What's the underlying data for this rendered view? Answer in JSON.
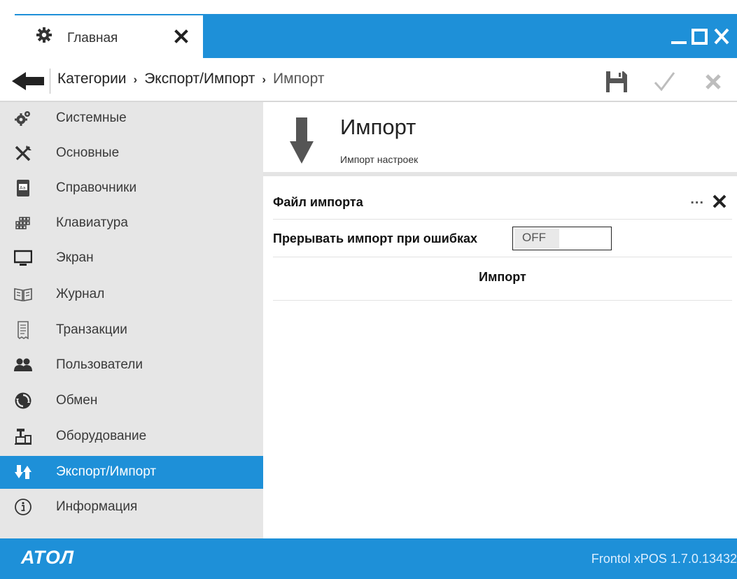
{
  "window": {
    "tab_label": "Главная",
    "controls": {
      "minimize_icon": "minimize-icon",
      "maximize_icon": "maximize-icon",
      "close_icon": "close-icon"
    }
  },
  "breadcrumb": {
    "items": [
      "Категории",
      "Экспорт/Импорт",
      "Импорт"
    ],
    "separator": "›"
  },
  "toolbar": {
    "save_icon": "save-icon",
    "apply_icon": "check-icon",
    "cancel_icon": "close-icon"
  },
  "sidebar": {
    "items": [
      {
        "label": "Системные",
        "icon": "gears-icon"
      },
      {
        "label": "Основные",
        "icon": "tools-icon"
      },
      {
        "label": "Справочники",
        "icon": "book-icon"
      },
      {
        "label": "Клавиатура",
        "icon": "keyboard-icon"
      },
      {
        "label": "Экран",
        "icon": "monitor-icon"
      },
      {
        "label": "Журнал",
        "icon": "open-book-icon"
      },
      {
        "label": "Транзакции",
        "icon": "receipt-icon"
      },
      {
        "label": "Пользователи",
        "icon": "users-icon"
      },
      {
        "label": "Обмен",
        "icon": "sync-icon"
      },
      {
        "label": "Оборудование",
        "icon": "pos-terminal-icon"
      },
      {
        "label": "Экспорт/Импорт",
        "icon": "export-import-icon",
        "active": true
      },
      {
        "label": "Информация",
        "icon": "info-icon"
      }
    ]
  },
  "main": {
    "title": "Импорт",
    "subtitle": "Импорт настроек",
    "file_label": "Файл импорта",
    "file_value": "",
    "browse_label": "...",
    "abort_label": "Прерывать импорт при ошибках",
    "abort_toggle": "OFF",
    "import_button": "Импорт"
  },
  "footer": {
    "logo": "АТОЛ",
    "version": "Frontol xPOS 1.7.0.13432"
  },
  "colors": {
    "accent": "#1e90d8",
    "sidebar_bg": "#e6e6e6",
    "icon_gray": "#555555"
  }
}
